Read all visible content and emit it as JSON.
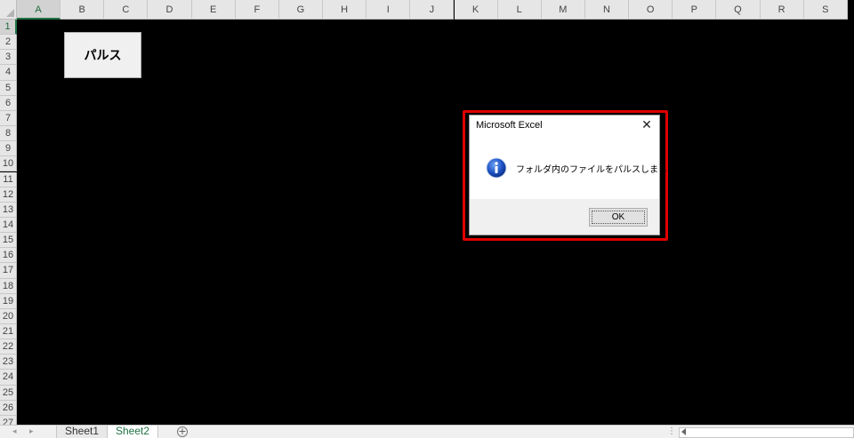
{
  "spreadsheet": {
    "columns": [
      "A",
      "B",
      "C",
      "D",
      "E",
      "F",
      "G",
      "H",
      "I",
      "J",
      "K",
      "L",
      "M",
      "N",
      "O",
      "P",
      "Q",
      "R",
      "S"
    ],
    "rows": [
      "1",
      "2",
      "3",
      "4",
      "5",
      "6",
      "7",
      "8",
      "9",
      "10",
      "11",
      "12",
      "13",
      "14",
      "15",
      "16",
      "17",
      "18",
      "19",
      "20",
      "21",
      "22",
      "23",
      "24",
      "25",
      "26",
      "27"
    ],
    "selected_column": "A",
    "selected_row": "1",
    "cell_background": "#000000"
  },
  "sheet_button": {
    "label": "パルス"
  },
  "dialog": {
    "title": "Microsoft Excel",
    "close_glyph": "✕",
    "message": "フォルダ内のファイルをパルスしました。",
    "icon": "information-icon",
    "ok_label": "OK",
    "highlight_color": "#e00000"
  },
  "tabs": {
    "sheets": [
      "Sheet1",
      "Sheet2"
    ],
    "active": "Sheet2",
    "add_glyph": "+"
  }
}
